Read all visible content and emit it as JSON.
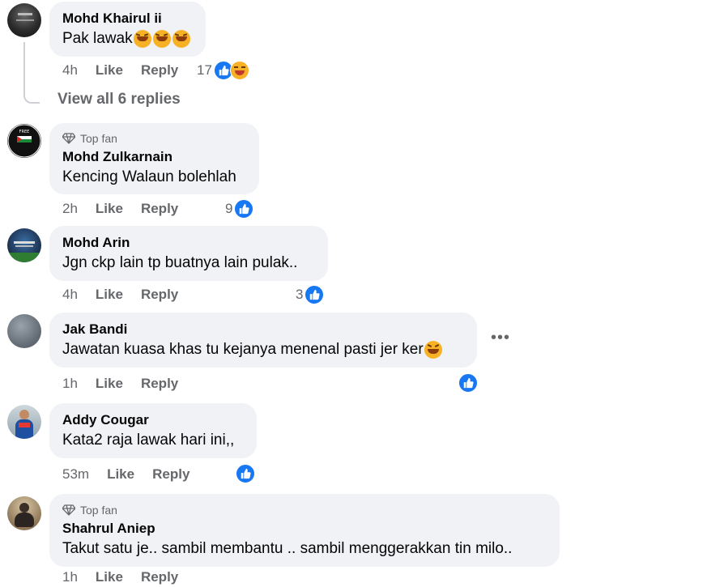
{
  "labels": {
    "like": "Like",
    "reply": "Reply"
  },
  "view_replies": "View all 6 replies",
  "colors": {
    "accent": "#1877f2",
    "bubble": "#f0f2f5",
    "meta": "#65676b"
  },
  "comments": [
    {
      "name": "Mohd Khairul ii",
      "text": "Pak lawak",
      "emojis": [
        "rolling-laughing-emoji",
        "rolling-laughing-emoji",
        "rolling-laughing-emoji"
      ],
      "time": "4h",
      "reaction_count": "17",
      "reactions": [
        "like-icon",
        "laughing-emoji-icon"
      ]
    },
    {
      "badge": "Top fan",
      "name": "Mohd Zulkarnain",
      "text": "Kencing Walaun bolehlah",
      "time": "2h",
      "reaction_count": "9",
      "reactions": [
        "like-icon"
      ]
    },
    {
      "name": "Mohd Arin",
      "text": "Jgn ckp lain tp buatnya lain pulak..",
      "time": "4h",
      "reaction_count": "3",
      "reactions": [
        "like-icon"
      ]
    },
    {
      "name": "Jak Bandi",
      "text": "Jawatan kuasa khas tu kejanya menenal pasti jer ker",
      "emojis": [
        "grinning-squinting-emoji"
      ],
      "time": "1h",
      "reaction_count": "",
      "reactions": [
        "like-icon"
      ]
    },
    {
      "name": "Addy Cougar",
      "text": "Kata2 raja lawak hari ini,,",
      "time": "53m",
      "reaction_count": "",
      "reactions": [
        "like-icon"
      ]
    },
    {
      "badge": "Top fan",
      "name": "Shahrul Aniep",
      "text": "Takut satu je.. sambil membantu .. sambil menggerakkan tin milo..",
      "time": "1h"
    }
  ]
}
